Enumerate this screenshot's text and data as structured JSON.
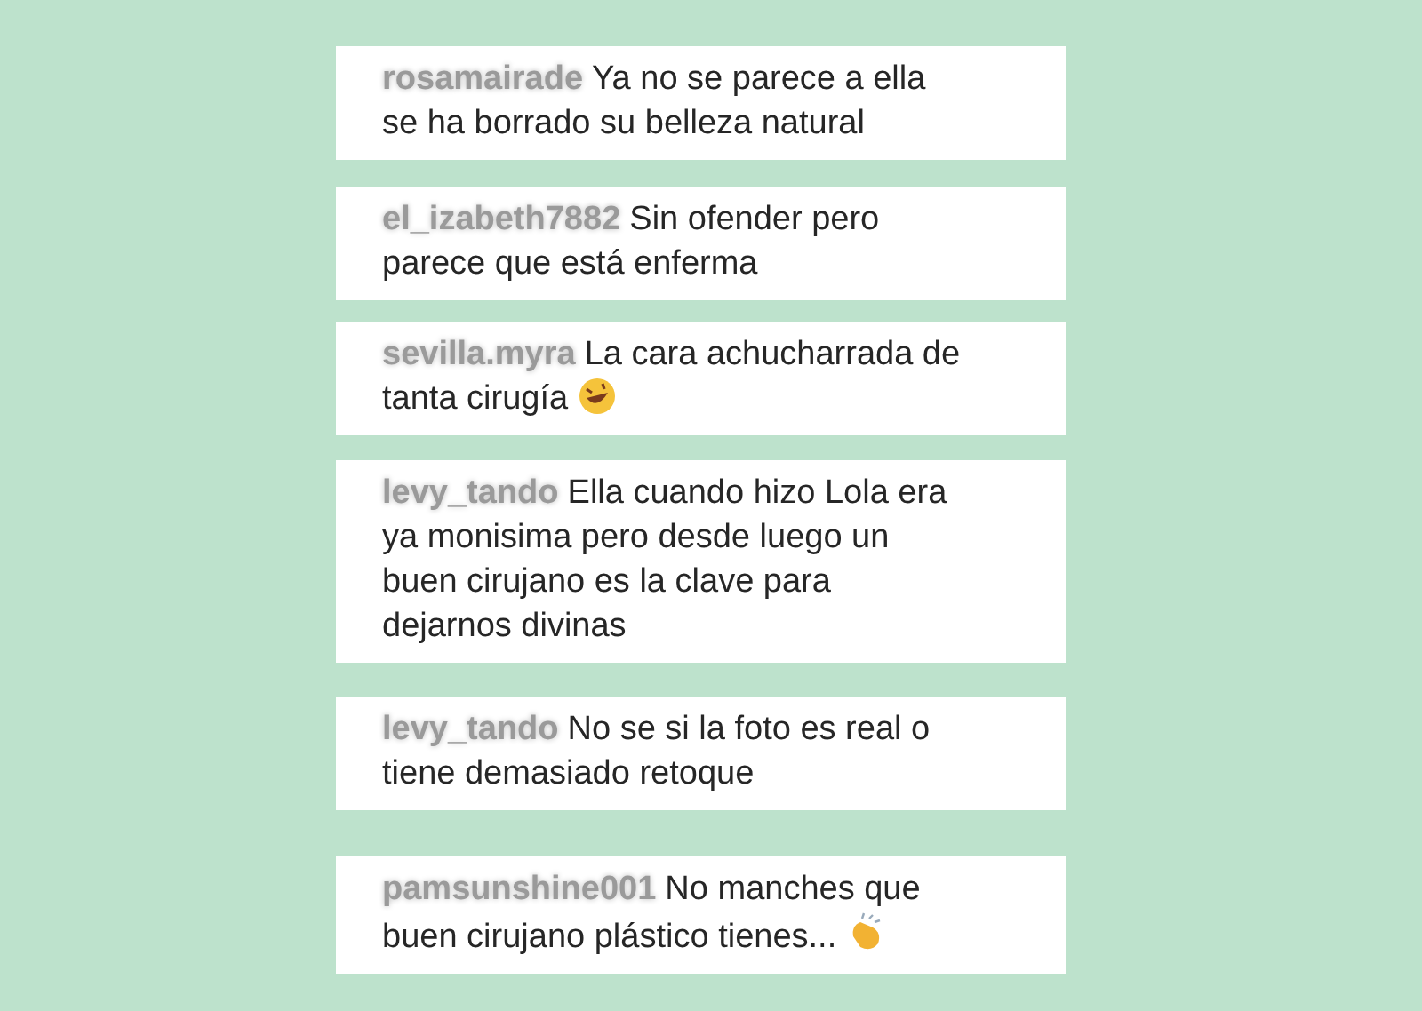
{
  "comments": [
    {
      "kind": "plain",
      "username": "rosamairade",
      "lines": [
        "Ya no se parece a ella",
        "se ha borrado su belleza natural"
      ]
    },
    {
      "kind": "plain",
      "username": "el_izabeth7882",
      "lines": [
        "Sin ofender pero",
        "parece que está enferma"
      ]
    },
    {
      "kind": "laughing",
      "username": "sevilla.myra",
      "lines": [
        "La cara achucharrada de",
        "tanta cirugía"
      ]
    },
    {
      "kind": "plain",
      "username": "levy_tando",
      "lines": [
        "Ella cuando hizo Lola era",
        "ya monisima pero desde luego un",
        "buen cirujano es la clave para",
        "dejarnos divinas"
      ]
    },
    {
      "kind": "plain",
      "username": "levy_tando",
      "lines": [
        "No se si la foto es real o",
        "tiene demasiado retoque"
      ]
    },
    {
      "kind": "clapping",
      "username": "pamsunshine001",
      "lines": [
        "No manches que",
        "buen cirujano plástico tienes..."
      ]
    }
  ]
}
